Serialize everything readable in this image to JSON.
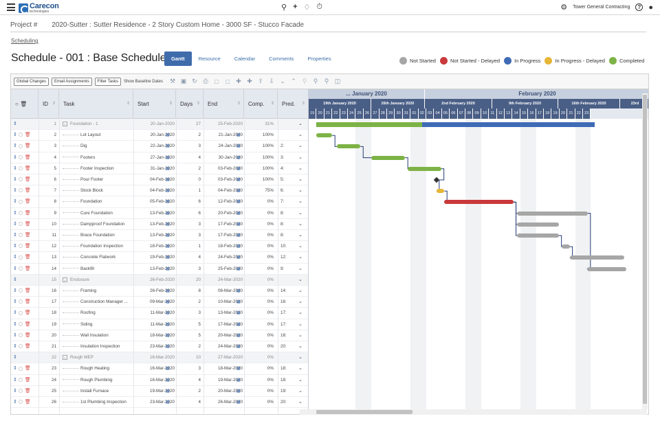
{
  "app": {
    "logo_name": "Carecon",
    "logo_sub": "technologies",
    "company": "Tower General Contracting"
  },
  "project": {
    "label": "Project #",
    "name": "2020-Sutter : Sutter Residence - 2 Story Custom Home - 3000 SF - Stucco Facade",
    "breadcrumb": "Scheduling"
  },
  "page": {
    "title": "Schedule - 001 : Base Schedule",
    "tabs": [
      "Gantt",
      "Resource",
      "Calendar",
      "Comments",
      "Properties"
    ],
    "active_tab": "Gantt"
  },
  "legend": [
    {
      "label": "Not Started",
      "color": "#a6a6a6"
    },
    {
      "label": "Not Started - Delayed",
      "color": "#c9393b"
    },
    {
      "label": "In Progress",
      "color": "#3f6bb5"
    },
    {
      "label": "In Progress - Delayed",
      "color": "#e6b637"
    },
    {
      "label": "Completed",
      "color": "#7db346"
    }
  ],
  "toolbar": {
    "global_changes": "Global Changes",
    "email_assignments": "Email Assignments",
    "filter_tasks": "Filter Tasks",
    "show_baseline": "Show Baseline Dates"
  },
  "columns": {
    "id": "ID",
    "task": "Task",
    "start": "Start",
    "days": "Days",
    "end": "End",
    "comp": "Comp.",
    "pred": "Pred."
  },
  "timeline": {
    "months": [
      "... January 2020",
      "February 2020"
    ],
    "weeks": [
      "19th January 2020",
      "26th January 2020",
      "2nd February 2020",
      "9th February 2020",
      "16th February 2020",
      "23rd"
    ],
    "days": [
      "19",
      "20",
      "21",
      "22",
      "23",
      "24",
      "25",
      "26",
      "27",
      "28",
      "29",
      "30",
      "31",
      "01",
      "02",
      "03",
      "04",
      "05",
      "06",
      "07",
      "08",
      "09",
      "10",
      "11",
      "12",
      "13",
      "14",
      "15",
      "16",
      "17",
      "18",
      "19",
      "20",
      "21",
      "22",
      "23"
    ]
  },
  "tasks": [
    {
      "id": "1",
      "task": "Foundation - 1",
      "start": "20-Jan-2020",
      "days": "27",
      "end": "25-Feb-2020",
      "comp": "31%",
      "pred": "",
      "summary": true
    },
    {
      "id": "2",
      "task": "Lot Layout",
      "start": "20-Jan-2020",
      "days": "2",
      "end": "21-Jan-2020",
      "comp": "100%",
      "pred": ""
    },
    {
      "id": "3",
      "task": "Dig",
      "start": "22-Jan-2020",
      "days": "3",
      "end": "24-Jan-2020",
      "comp": "100%",
      "pred": "2:"
    },
    {
      "id": "4",
      "task": "Footers",
      "start": "27-Jan-2020",
      "days": "4",
      "end": "30-Jan-2020",
      "comp": "100%",
      "pred": "3:"
    },
    {
      "id": "5",
      "task": "Footer Inspection",
      "start": "31-Jan-2020",
      "days": "2",
      "end": "03-Feb-2020",
      "comp": "100%",
      "pred": "4:"
    },
    {
      "id": "6",
      "task": "Pour Footer",
      "start": "04-Feb-2020",
      "days": "0",
      "end": "03-Feb-2020",
      "comp": "100%",
      "pred": "5:"
    },
    {
      "id": "7",
      "task": "Stock Block",
      "start": "04-Feb-2020",
      "days": "1",
      "end": "04-Feb-2020",
      "comp": "75%",
      "pred": "6:"
    },
    {
      "id": "8",
      "task": "Foundation",
      "start": "05-Feb-2020",
      "days": "6",
      "end": "12-Feb-2020",
      "comp": "0%",
      "pred": "7:"
    },
    {
      "id": "9",
      "task": "Cure Foundation",
      "start": "13-Feb-2020",
      "days": "6",
      "end": "20-Feb-2020",
      "comp": "0%",
      "pred": "8:"
    },
    {
      "id": "10",
      "task": "Dampproof Foundation",
      "start": "13-Feb-2020",
      "days": "3",
      "end": "17-Feb-2020",
      "comp": "0%",
      "pred": "8:"
    },
    {
      "id": "11",
      "task": "Brace Foundation",
      "start": "13-Feb-2020",
      "days": "3",
      "end": "17-Feb-2020",
      "comp": "0%",
      "pred": "8:"
    },
    {
      "id": "12",
      "task": "Foundation Inspection",
      "start": "18-Feb-2020",
      "days": "1",
      "end": "18-Feb-2020",
      "comp": "0%",
      "pred": "10:"
    },
    {
      "id": "13",
      "task": "Concrete Flatwork",
      "start": "19-Feb-2020",
      "days": "4",
      "end": "24-Feb-2020",
      "comp": "0%",
      "pred": "12:"
    },
    {
      "id": "14",
      "task": "Backfill",
      "start": "13-Feb-2020",
      "days": "3",
      "end": "25-Feb-2020",
      "comp": "0%",
      "pred": "9:"
    },
    {
      "id": "15",
      "task": "Enclosure",
      "start": "26-Feb-2020",
      "days": "20",
      "end": "24-Mar-2020",
      "comp": "0%",
      "pred": "",
      "summary": true
    },
    {
      "id": "16",
      "task": "Framing",
      "start": "26-Feb-2020",
      "days": "8",
      "end": "06-Mar-2020",
      "comp": "0%",
      "pred": "14:"
    },
    {
      "id": "17",
      "task": "Construction Manager ...",
      "start": "09-Mar-2020",
      "days": "2",
      "end": "10-Mar-2020",
      "comp": "0%",
      "pred": "16:"
    },
    {
      "id": "18",
      "task": "Roofing",
      "start": "11-Mar-2020",
      "days": "3",
      "end": "13-Mar-2020",
      "comp": "0%",
      "pred": "17:"
    },
    {
      "id": "19",
      "task": "Siding",
      "start": "11-Mar-2020",
      "days": "5",
      "end": "17-Mar-2020",
      "comp": "0%",
      "pred": "17:"
    },
    {
      "id": "20",
      "task": "Wall Insulation",
      "start": "18-Mar-2020",
      "days": "5",
      "end": "20-Mar-2020",
      "comp": "0%",
      "pred": "18:"
    },
    {
      "id": "21",
      "task": "Insulation Inspection",
      "start": "23-Mar-2020",
      "days": "2",
      "end": "24-Mar-2020",
      "comp": "0%",
      "pred": "20:"
    },
    {
      "id": "22",
      "task": "Rough MEP",
      "start": "16-Mar-2020",
      "days": "10",
      "end": "27-Mar-2020",
      "comp": "0%",
      "pred": "",
      "summary": true
    },
    {
      "id": "23",
      "task": "Rough Heating",
      "start": "16-Mar-2020",
      "days": "3",
      "end": "18-Mar-2020",
      "comp": "0%",
      "pred": "18:"
    },
    {
      "id": "24",
      "task": "Rough Plumbing",
      "start": "16-Mar-2020",
      "days": "4",
      "end": "19-Mar-2020",
      "comp": "0%",
      "pred": "18:"
    },
    {
      "id": "25",
      "task": "Install Furnace",
      "start": "19-Mar-2020",
      "days": "2",
      "end": "20-Mar-2020",
      "comp": "0%",
      "pred": "19:"
    },
    {
      "id": "26",
      "task": "1st Plumbing Inspection",
      "start": "23-Mar-2020",
      "days": "4",
      "end": "26-Mar-2020",
      "comp": "0%",
      "pred": "20:"
    }
  ],
  "bars": [
    {
      "row": 0,
      "start": 1,
      "len": 13.5,
      "color": "#7db346"
    },
    {
      "row": 0,
      "start": 14.5,
      "len": 22,
      "color": "#3f6bb5"
    },
    {
      "row": 1,
      "start": 1,
      "len": 2,
      "color": "#7db346"
    },
    {
      "row": 2,
      "start": 3.6,
      "len": 3,
      "color": "#7db346"
    },
    {
      "row": 3,
      "start": 8,
      "len": 4.3,
      "color": "#7db346"
    },
    {
      "row": 4,
      "start": 12.6,
      "len": 4.3,
      "color": "#7db346"
    },
    {
      "row": 6,
      "start": 16.3,
      "len": 1,
      "color": "#e6b637"
    },
    {
      "row": 7,
      "start": 17.3,
      "len": 8.8,
      "color": "#c9393b"
    },
    {
      "row": 8,
      "start": 26.6,
      "len": 9,
      "color": "#a6a6a6"
    },
    {
      "row": 9,
      "start": 26.6,
      "len": 5.3,
      "color": "#a6a6a6"
    },
    {
      "row": 10,
      "start": 26.6,
      "len": 5.3,
      "color": "#a6a6a6"
    },
    {
      "row": 11,
      "start": 32.3,
      "len": 1,
      "color": "#a6a6a6"
    },
    {
      "row": 12,
      "start": 33.3,
      "len": 7,
      "color": "#a6a6a6"
    },
    {
      "row": 13,
      "start": 35.5,
      "len": 5,
      "color": "#a6a6a6"
    }
  ],
  "milestones": [
    {
      "row": 5,
      "start": 16.3
    }
  ],
  "icons": {
    "menu": "hamburger-icon",
    "search": "search-icon",
    "add": "plus-icon",
    "bell": "bell-icon",
    "timer": "stopwatch-icon",
    "settings": "gear-icon",
    "help": "help-icon",
    "user": "user-icon"
  }
}
